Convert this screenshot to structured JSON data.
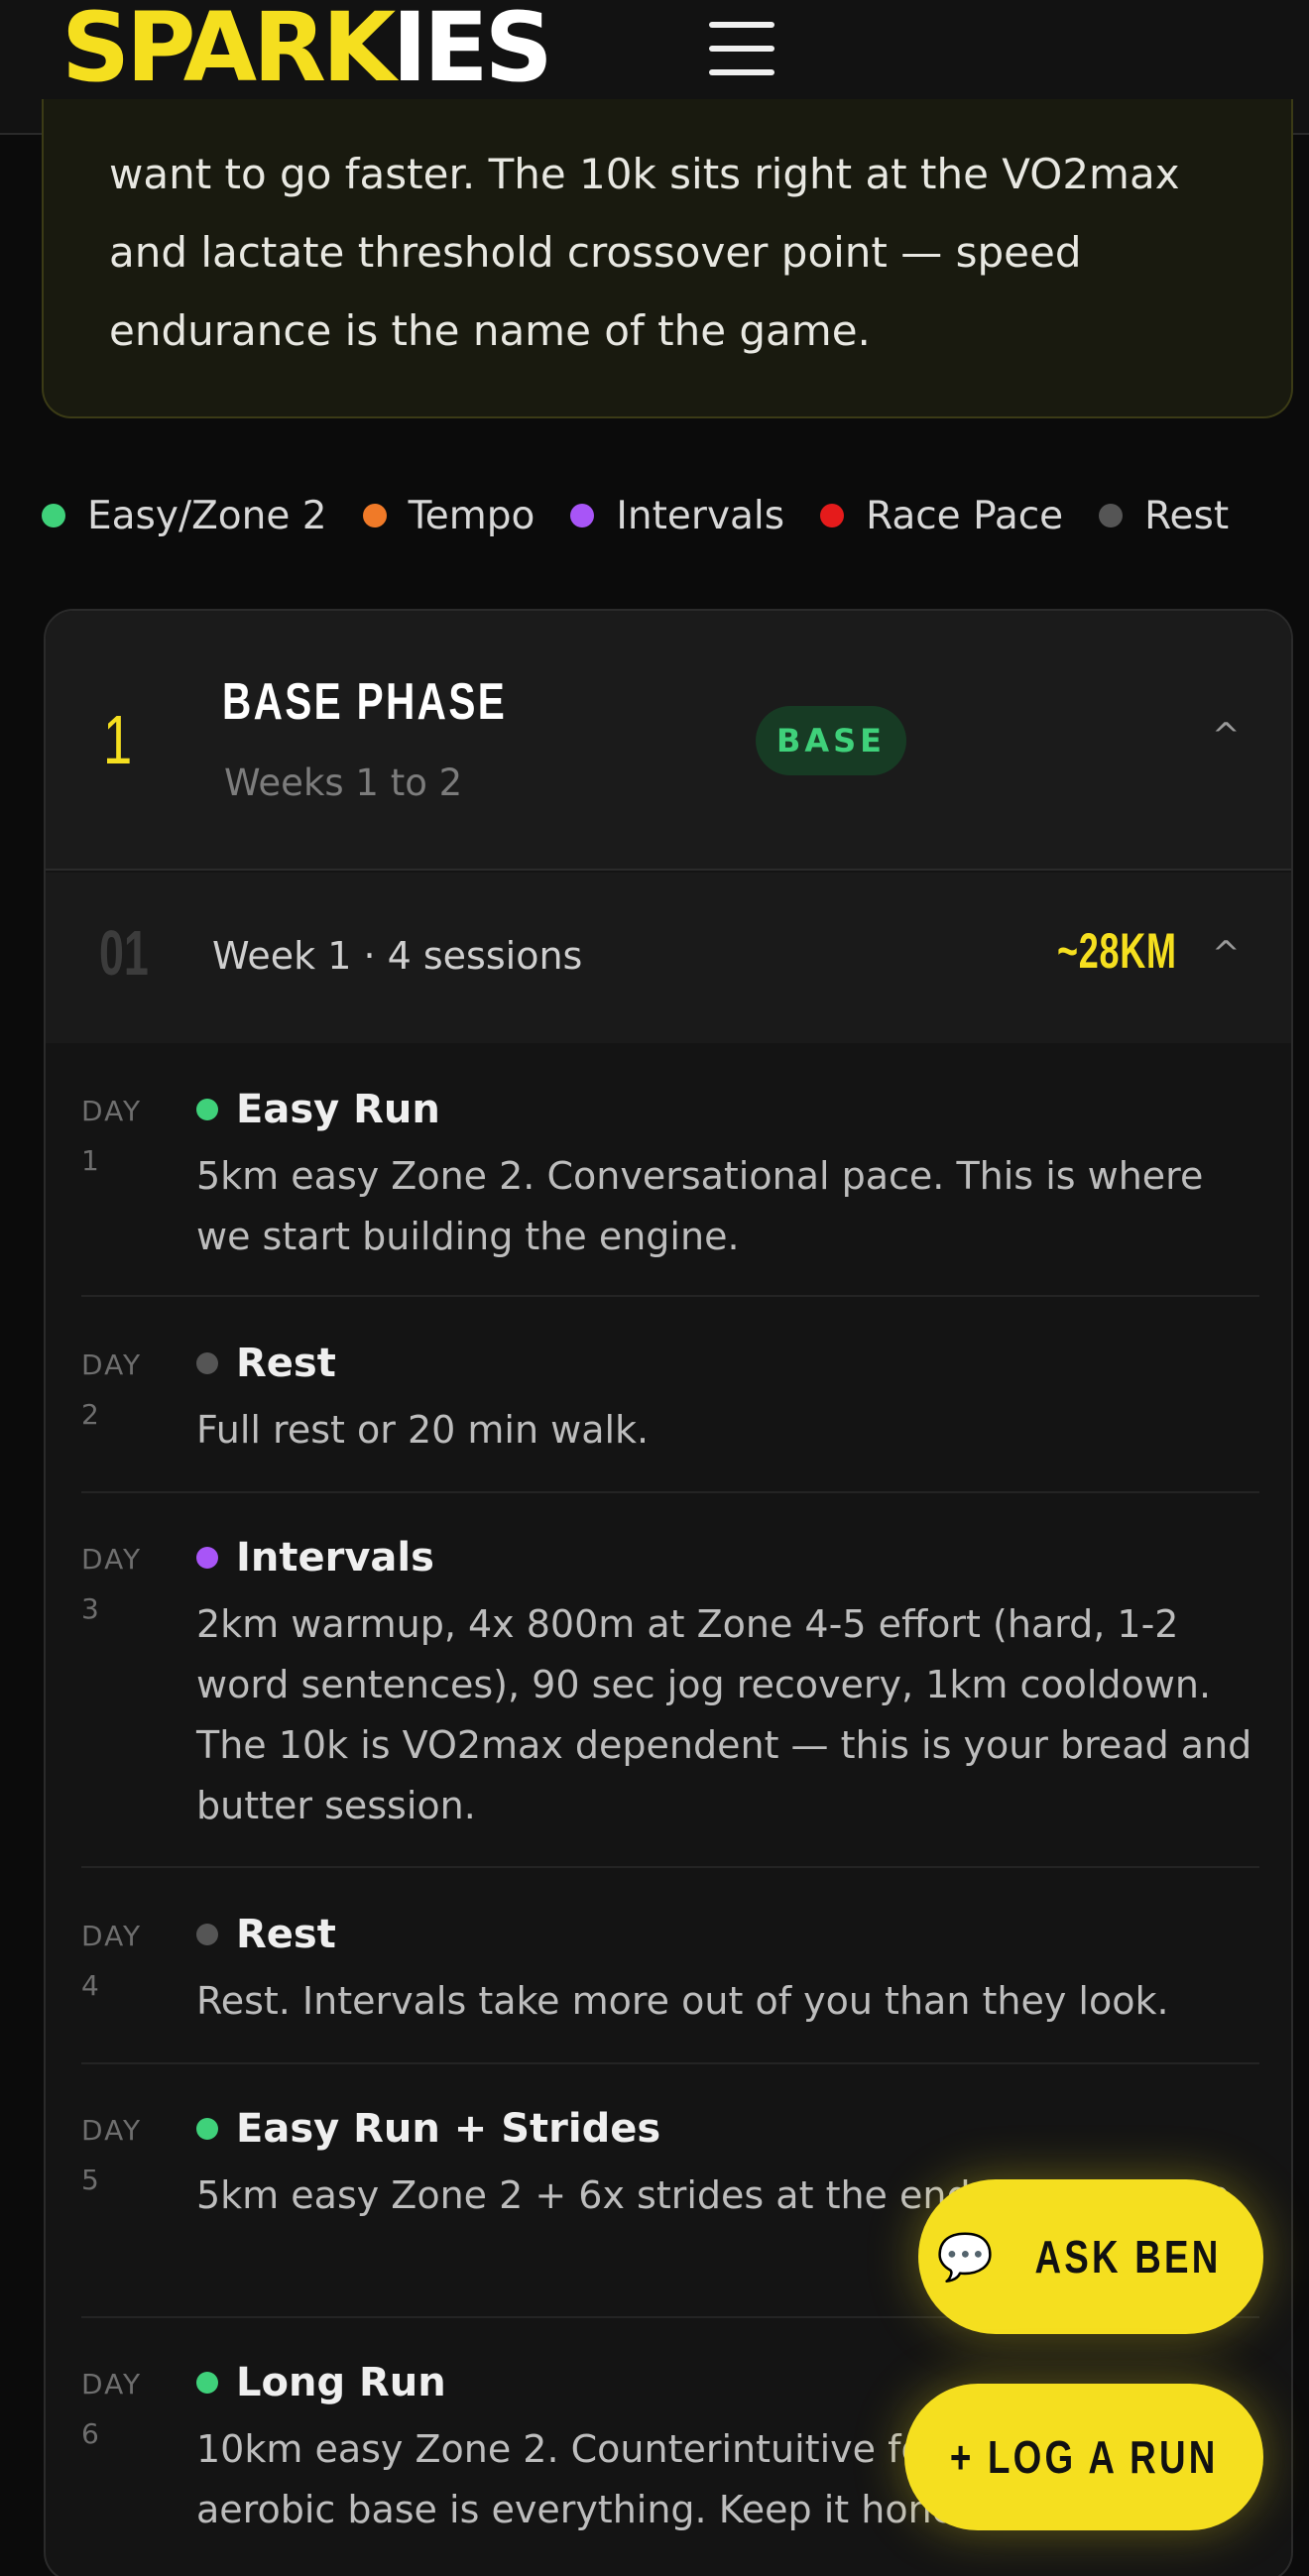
{
  "header": {
    "logo_part1": "SPARK",
    "logo_part2": "IES",
    "menu_icon": "hamburger-menu-icon"
  },
  "intro": {
    "text": "want to go faster. The 10k sits right at the VO2max and lactate threshold crossover point — speed endurance is the name of the game."
  },
  "legend": [
    {
      "label": "Easy/Zone 2",
      "color": "#3fd17a"
    },
    {
      "label": "Tempo",
      "color": "#f07a28"
    },
    {
      "label": "Intervals",
      "color": "#a855f7"
    },
    {
      "label": "Race Pace",
      "color": "#e51b1b"
    },
    {
      "label": "Rest",
      "color": "#555555"
    }
  ],
  "phase": {
    "number": "1",
    "title": "BASE PHASE",
    "subtitle": "Weeks 1 to 2",
    "badge": "BASE",
    "chevron": "^"
  },
  "week": {
    "number": "01",
    "label": "Week 1 · 4 sessions",
    "distance": "~28KM",
    "chevron": "^"
  },
  "days": [
    {
      "label": "DAY",
      "num": "1",
      "title": "Easy Run",
      "color": "#3fd17a",
      "desc": "5km easy Zone 2. Conversational pace. This is where we start building the engine."
    },
    {
      "label": "DAY",
      "num": "2",
      "title": "Rest",
      "color": "#555555",
      "desc": "Full rest or 20 min walk."
    },
    {
      "label": "DAY",
      "num": "3",
      "title": "Intervals",
      "color": "#a855f7",
      "desc": "2km warmup, 4x 800m at Zone 4-5 effort (hard, 1-2 word sentences), 90 sec jog recovery, 1km cooldown. The 10k is VO2max dependent — this is your bread and butter session."
    },
    {
      "label": "DAY",
      "num": "4",
      "title": "Rest",
      "color": "#555555",
      "desc": "Rest. Intervals take more out of you than they look."
    },
    {
      "label": "DAY",
      "num": "5",
      "title": "Easy Run + Strides",
      "color": "#3fd17a",
      "desc": "5km easy Zone 2 + 6x strides at the end to stay sharp."
    },
    {
      "label": "DAY",
      "num": "6",
      "title": "Long Run",
      "color": "#3fd17a",
      "desc": "10km easy Zone 2. Counterintuitive for a 10k but aerobic base is everything. Keep it honest."
    }
  ],
  "buttons": {
    "ask_icon": "💬",
    "ask_label": "ASK BEN",
    "log_label": "+ LOG A RUN"
  }
}
